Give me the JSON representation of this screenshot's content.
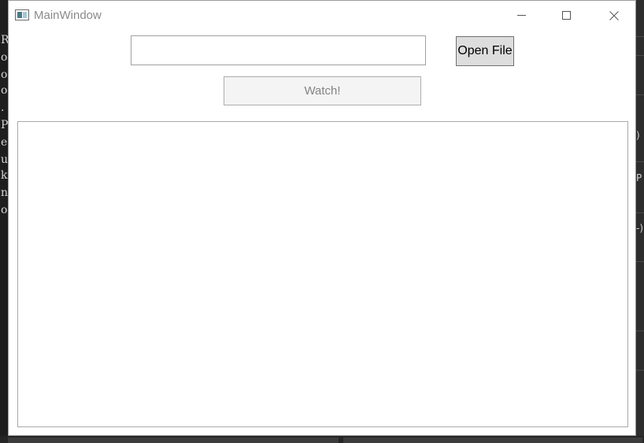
{
  "window": {
    "title": "MainWindow",
    "icon": "window-app-icon",
    "controls": {
      "minimize": "minimize-icon",
      "maximize": "maximize-icon",
      "close": "close-icon"
    }
  },
  "toolbar": {
    "file_path_value": "",
    "open_file_label": "Open File",
    "watch_label": "Watch!"
  },
  "output": {
    "text": ""
  },
  "background_editor": {
    "left_chars": [
      "R",
      "o",
      "o",
      "o",
      ".",
      "P",
      "e",
      "u",
      "k",
      "n",
      "o"
    ],
    "right_chars": [
      ")",
      "P",
      "-)"
    ]
  },
  "colors": {
    "window_bg": "#ffffff",
    "title_text": "#8a8a8a",
    "button_bg": "#dddddd",
    "disabled_button_bg": "#f4f4f4",
    "disabled_text": "#838383",
    "border": "#a0a0a0",
    "desktop_bg": "#1e1e1e"
  }
}
